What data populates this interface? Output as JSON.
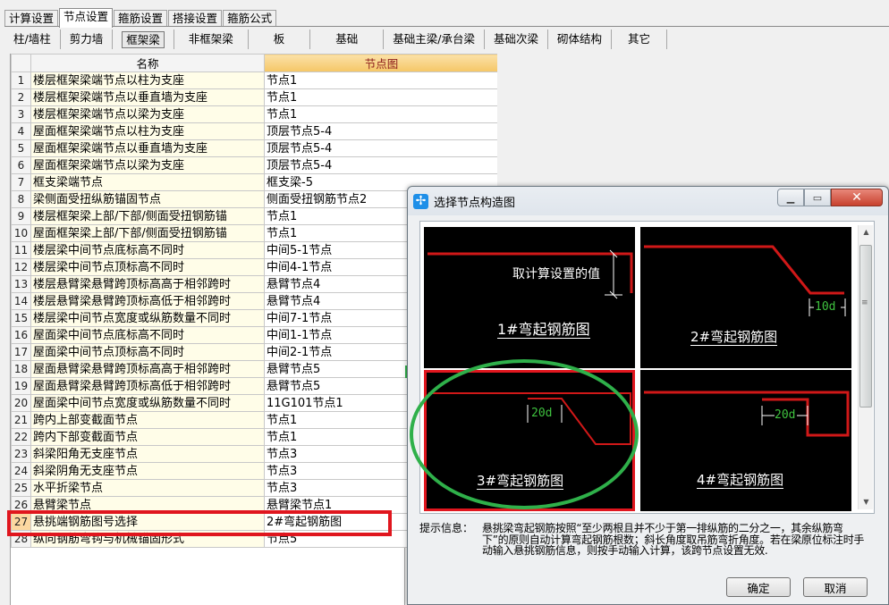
{
  "top_tabs": [
    {
      "label": "计算设置",
      "active": false
    },
    {
      "label": "节点设置",
      "active": true
    },
    {
      "label": "箍筋设置",
      "active": false
    },
    {
      "label": "搭接设置",
      "active": false
    },
    {
      "label": "箍筋公式",
      "active": false
    }
  ],
  "sub_tabs": [
    {
      "label": "柱/墙柱",
      "active": false
    },
    {
      "label": "剪力墙",
      "active": false
    },
    {
      "label": "框架梁",
      "active": true
    },
    {
      "label": "非框架梁",
      "active": false
    },
    {
      "label": "板",
      "active": false
    },
    {
      "label": "基础",
      "active": false
    },
    {
      "label": "基础主梁/承台梁",
      "active": false
    },
    {
      "label": "基础次梁",
      "active": false
    },
    {
      "label": "砌体结构",
      "active": false
    },
    {
      "label": "其它",
      "active": false
    }
  ],
  "grid": {
    "columns": [
      "",
      "名称",
      "节点图"
    ],
    "selected_row": 27,
    "rows": [
      {
        "num": "1",
        "name": "楼层框架梁端节点以柱为支座",
        "pic": "节点1"
      },
      {
        "num": "2",
        "name": "楼层框架梁端节点以垂直墙为支座",
        "pic": "节点1"
      },
      {
        "num": "3",
        "name": "楼层框架梁端节点以梁为支座",
        "pic": "节点1"
      },
      {
        "num": "4",
        "name": "屋面框架梁端节点以柱为支座",
        "pic": "顶层节点5-4"
      },
      {
        "num": "5",
        "name": "屋面框架梁端节点以垂直墙为支座",
        "pic": "顶层节点5-4"
      },
      {
        "num": "6",
        "name": "屋面框架梁端节点以梁为支座",
        "pic": "顶层节点5-4"
      },
      {
        "num": "7",
        "name": "框支梁端节点",
        "pic": "框支梁-5"
      },
      {
        "num": "8",
        "name": "梁侧面受扭纵筋锚固节点",
        "pic": "侧面受扭钢筋节点2"
      },
      {
        "num": "9",
        "name": "楼层框架梁上部/下部/侧面受扭钢筋锚",
        "pic": "节点1"
      },
      {
        "num": "10",
        "name": "屋面框架梁上部/下部/侧面受扭钢筋锚",
        "pic": "节点1"
      },
      {
        "num": "11",
        "name": "楼层梁中间节点底标高不同时",
        "pic": "中间5-1节点"
      },
      {
        "num": "12",
        "name": "楼层梁中间节点顶标高不同时",
        "pic": "中间4-1节点"
      },
      {
        "num": "13",
        "name": "楼层悬臂梁悬臂跨顶标高高于相邻跨时",
        "pic": "悬臂节点4"
      },
      {
        "num": "14",
        "name": "楼层悬臂梁悬臂跨顶标高低于相邻跨时",
        "pic": "悬臂节点4"
      },
      {
        "num": "15",
        "name": "楼层梁中间节点宽度或纵筋数量不同时",
        "pic": "中间7-1节点"
      },
      {
        "num": "16",
        "name": "屋面梁中间节点底标高不同时",
        "pic": "中间1-1节点"
      },
      {
        "num": "17",
        "name": "屋面梁中间节点顶标高不同时",
        "pic": "中间2-1节点"
      },
      {
        "num": "18",
        "name": "屋面悬臂梁悬臂跨顶标高高于相邻跨时",
        "pic": "悬臂节点5"
      },
      {
        "num": "19",
        "name": "屋面悬臂梁悬臂跨顶标高低于相邻跨时",
        "pic": "悬臂节点5"
      },
      {
        "num": "20",
        "name": "屋面梁中间节点宽度或纵筋数量不同时",
        "pic": "11G101节点1"
      },
      {
        "num": "21",
        "name": "跨内上部变截面节点",
        "pic": "节点1"
      },
      {
        "num": "22",
        "name": "跨内下部变截面节点",
        "pic": "节点1"
      },
      {
        "num": "23",
        "name": "斜梁阳角无支座节点",
        "pic": "节点3"
      },
      {
        "num": "24",
        "name": "斜梁阴角无支座节点",
        "pic": "节点3"
      },
      {
        "num": "25",
        "name": "水平折梁节点",
        "pic": "节点3"
      },
      {
        "num": "26",
        "name": "悬臂梁节点",
        "pic": "悬臂梁节点1"
      },
      {
        "num": "27",
        "name": "悬挑端钢筋图号选择",
        "pic": "2#弯起钢筋图"
      },
      {
        "num": "28",
        "name": "纵向钢筋弯钩与机械锚固形式",
        "pic": "节点5"
      }
    ]
  },
  "dialog": {
    "title": "选择节点构造图",
    "icon": "app-icon",
    "window_buttons": {
      "minimize": "minimize-icon",
      "maximize": "maximize-icon",
      "close": "close-icon"
    },
    "images": [
      {
        "label": "1#弯起钢筋图",
        "note": "取计算设置的值",
        "dim": ""
      },
      {
        "label": "2#弯起钢筋图",
        "note": "",
        "dim": "10d"
      },
      {
        "label": "3#弯起钢筋图",
        "note": "",
        "dim": "20d"
      },
      {
        "label": "4#弯起钢筋图",
        "note": "",
        "dim": "20d"
      }
    ],
    "selected_image": 3,
    "hint_label": "提示信息：",
    "hint_text": "悬挑梁弯起钢筋按照“至少两根且并不少于第一排纵筋的二分之一，其余纵筋弯下”的原则自动计算弯起钢筋根数；斜长角度取吊筋弯折角度。若在梁原位标注时手动输入悬挑钢筋信息，则按手动输入计算，该跨节点设置无效.",
    "ok_label": "确定",
    "cancel_label": "取消"
  },
  "colors": {
    "annotation_red": "#e0161e",
    "annotation_green": "#2fb04a",
    "rebar_red": "#d01818",
    "dim_green": "#3fc23f"
  }
}
